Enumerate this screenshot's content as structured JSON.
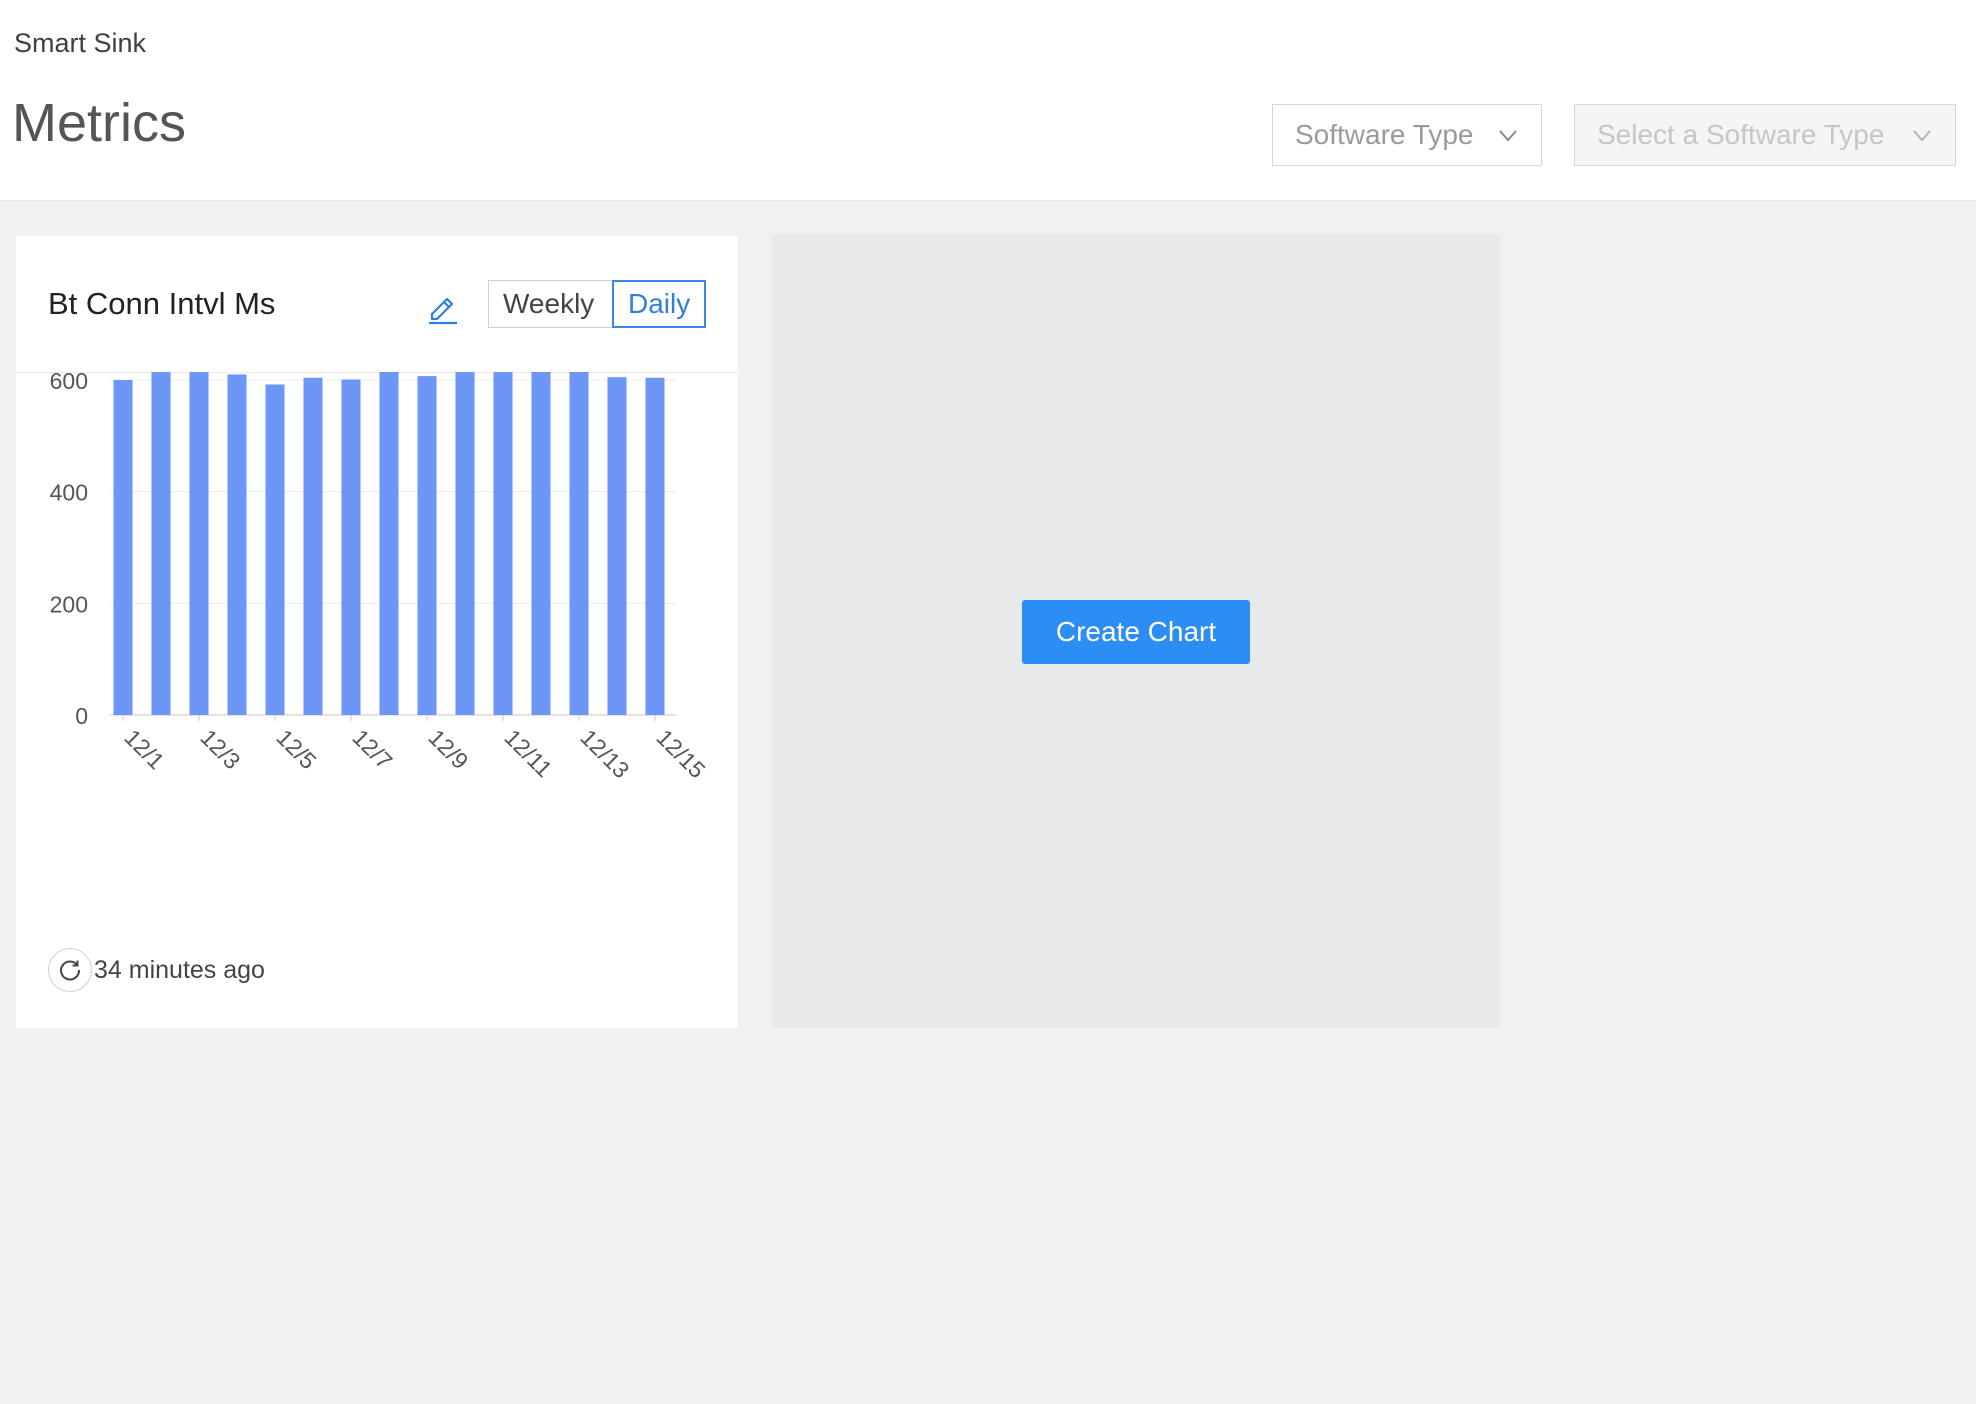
{
  "header": {
    "app_name": "Smart Sink",
    "page_title": "Metrics",
    "software_type_select": {
      "label": "Software Type",
      "icon": "chevron-down-icon"
    },
    "software_select": {
      "placeholder": "Select a Software Type",
      "icon": "chevron-down-icon",
      "disabled": true
    }
  },
  "metric_card": {
    "title": "Bt Conn Intvl Ms",
    "edit_icon": "pencil-icon",
    "toggle": {
      "weekly_label": "Weekly",
      "daily_label": "Daily",
      "selected": "Daily"
    },
    "refresh": {
      "icon": "refresh-icon",
      "label": "34 minutes ago"
    }
  },
  "chart_data": {
    "type": "bar",
    "title": "",
    "xlabel": "",
    "ylabel": "",
    "categories": [
      "12/1",
      "12/2",
      "12/3",
      "12/4",
      "12/5",
      "12/6",
      "12/7",
      "12/8",
      "12/9",
      "12/10",
      "12/11",
      "12/12",
      "12/13",
      "12/14",
      "12/15"
    ],
    "x_tick_labels": [
      "12/1",
      "12/3",
      "12/5",
      "12/7",
      "12/9",
      "12/11",
      "12/13",
      "12/15"
    ],
    "values": [
      600,
      622,
      635,
      610,
      592,
      604,
      601,
      638,
      607,
      625,
      627,
      616,
      623,
      605,
      604
    ],
    "ylim": [
      0,
      650
    ],
    "yticks": [
      0,
      200,
      400,
      600
    ],
    "grid": true,
    "color": "#6c96f5"
  },
  "placeholder_card": {
    "create_label": "Create Chart"
  },
  "colors": {
    "accent": "#2c8ef5",
    "bar": "#6c96f5",
    "background": "#f0f1f3"
  }
}
